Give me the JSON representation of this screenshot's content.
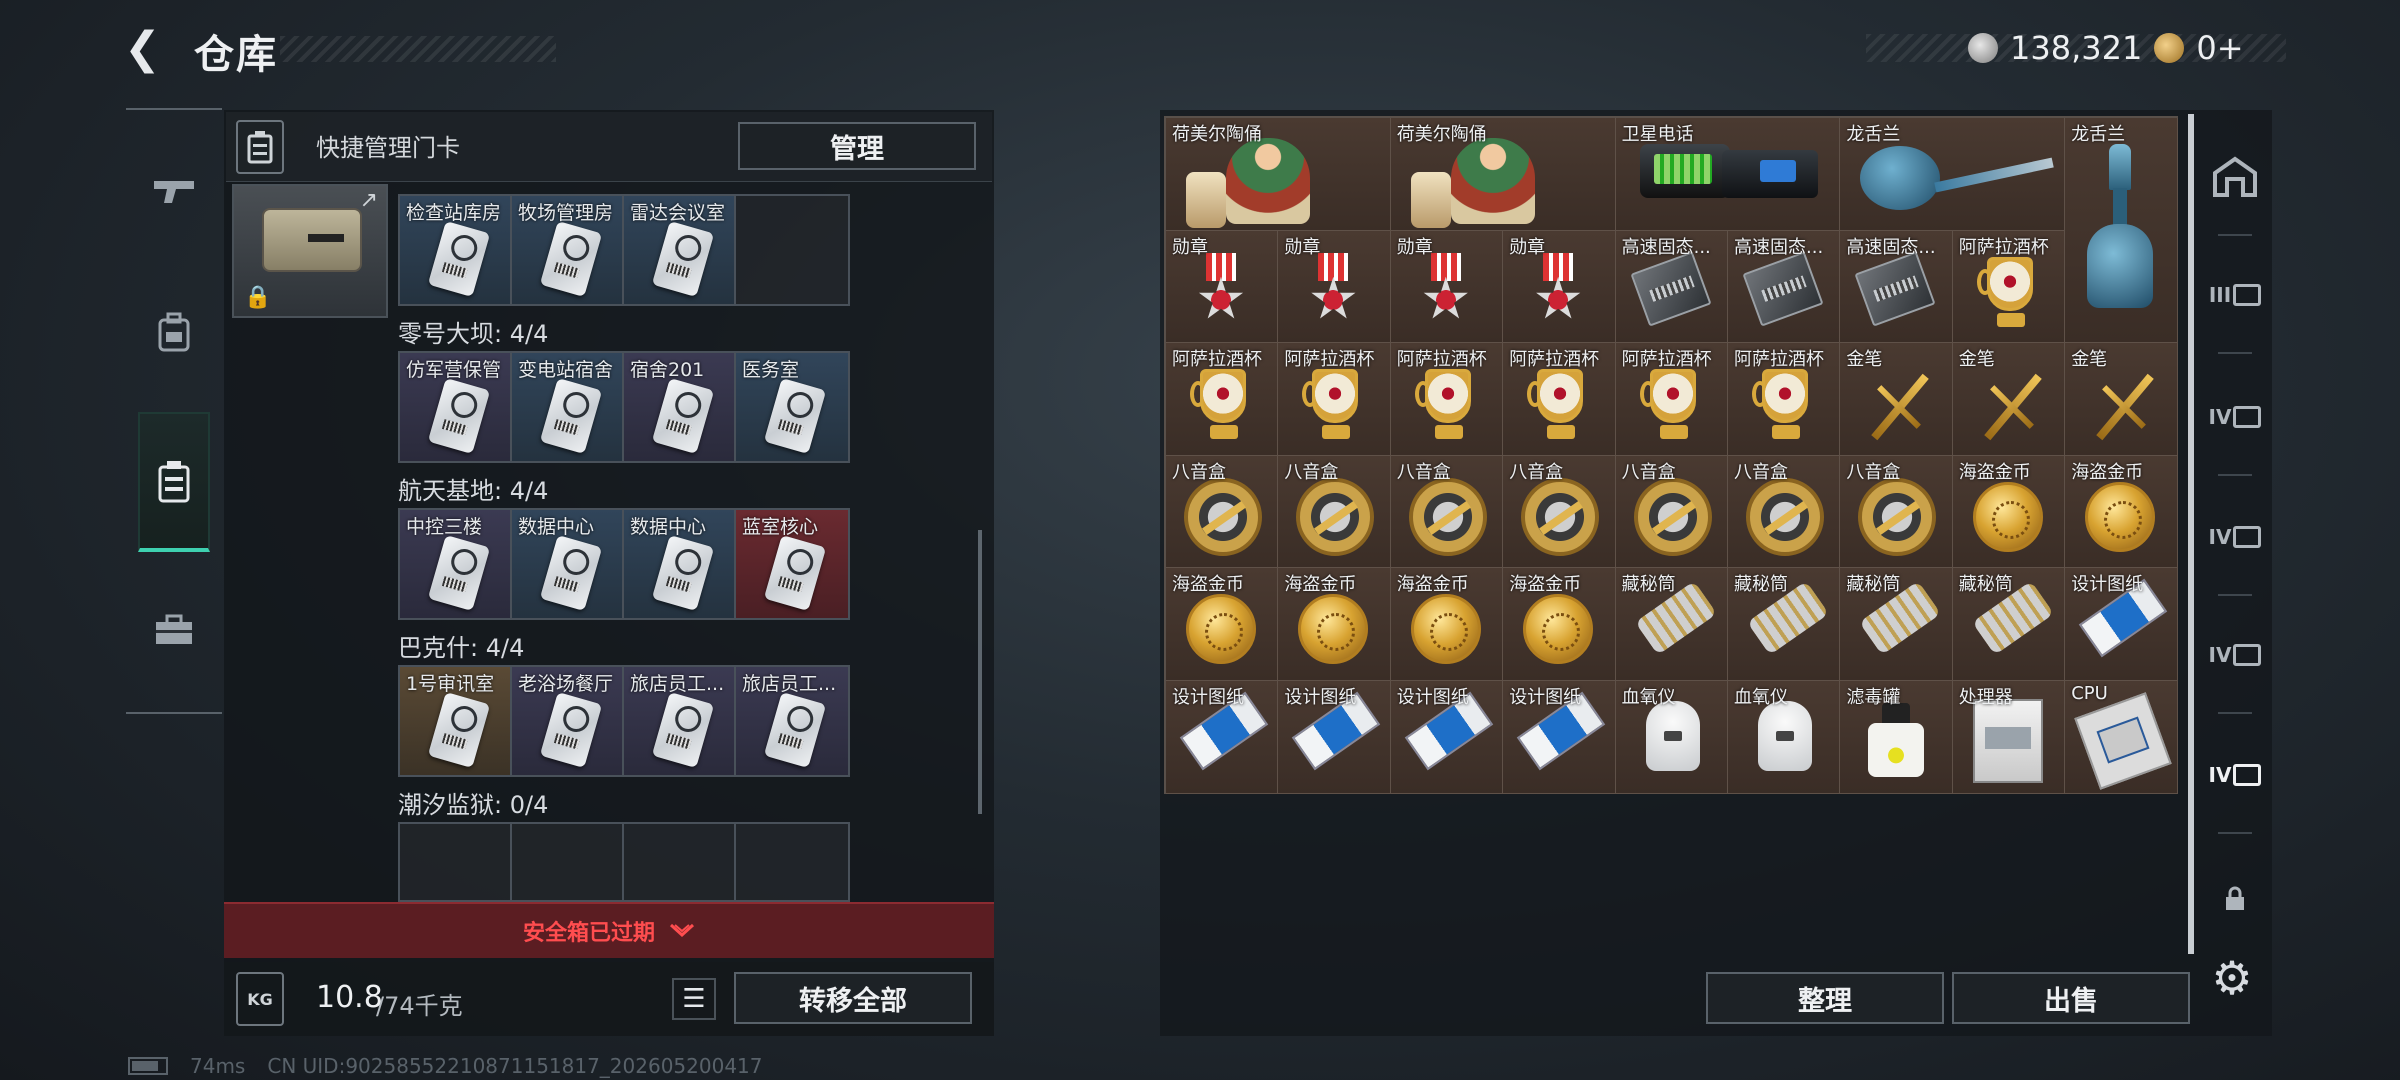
{
  "header": {
    "title": "仓库",
    "currency": [
      {
        "icon": "silver-coin-icon",
        "value": "138,321"
      },
      {
        "icon": "gold-coin-icon",
        "value": "0+"
      }
    ]
  },
  "left_nav": [
    {
      "icon": "gun-icon"
    },
    {
      "icon": "backpack-icon"
    },
    {
      "icon": "keycard-case-icon",
      "active": true
    },
    {
      "icon": "toolbox-icon"
    }
  ],
  "key_panel": {
    "header_label": "快捷管理门卡",
    "manage_button": "管理",
    "sections": [
      {
        "label": "",
        "slots": [
          {
            "name": "检查站库房",
            "color": "blue"
          },
          {
            "name": "牧场管理房",
            "color": "blue"
          },
          {
            "name": "雷达会议室",
            "color": "blue"
          },
          {
            "name": "",
            "color": "empty"
          }
        ]
      },
      {
        "label": "零号大坝: 4/4",
        "slots": [
          {
            "name": "仿军营保管",
            "color": "purple"
          },
          {
            "name": "变电站宿舍",
            "color": "blue"
          },
          {
            "name": "宿舍201",
            "color": "purple"
          },
          {
            "name": "医务室",
            "color": "blue"
          }
        ]
      },
      {
        "label": "航天基地: 4/4",
        "slots": [
          {
            "name": "中控三楼",
            "color": "purple"
          },
          {
            "name": "数据中心",
            "color": "blue"
          },
          {
            "name": "数据中心",
            "color": "blue"
          },
          {
            "name": "蓝室核心",
            "color": "red"
          }
        ]
      },
      {
        "label": "巴克什: 4/4",
        "slots": [
          {
            "name": "1号审讯室",
            "color": "gold"
          },
          {
            "name": "老浴场餐厅",
            "color": "purple"
          },
          {
            "name": "旅店员工...",
            "color": "purple"
          },
          {
            "name": "旅店员工...",
            "color": "purple"
          }
        ]
      },
      {
        "label": "潮汐监狱: 0/4",
        "slots": [
          {
            "name": "",
            "color": "empty"
          },
          {
            "name": "",
            "color": "empty"
          },
          {
            "name": "",
            "color": "empty"
          },
          {
            "name": "",
            "color": "empty"
          }
        ]
      }
    ],
    "expired_label": "安全箱已过期",
    "weight_current": "10.8",
    "weight_max": "/74千克",
    "weight_icon_text": "KG",
    "transfer_button": "转移全部"
  },
  "status_bar": {
    "ping": "74ms",
    "uid": "CN UID:9025855221087115181​7_202605200417"
  },
  "stash": {
    "items": [
      {
        "name": "荷美尔陶俑",
        "art": "fig",
        "w": 2,
        "h": 1
      },
      {
        "name": "荷美尔陶俑",
        "art": "fig",
        "w": 2,
        "h": 1
      },
      {
        "name": "卫星电话",
        "art": "phone",
        "w": 2,
        "h": 1
      },
      {
        "name": "龙舌兰",
        "art": "vase",
        "w": 2,
        "h": 1
      },
      {
        "name": "龙舌兰",
        "art": "bottle",
        "w": 1,
        "h": 2
      },
      {
        "name": "勋章",
        "art": "medal",
        "w": 1,
        "h": 1
      },
      {
        "name": "勋章",
        "art": "medal",
        "w": 1,
        "h": 1
      },
      {
        "name": "勋章",
        "art": "medal",
        "w": 1,
        "h": 1
      },
      {
        "name": "勋章",
        "art": "medal",
        "w": 1,
        "h": 1
      },
      {
        "name": "高速固态...",
        "art": "ssd",
        "w": 1,
        "h": 1
      },
      {
        "name": "高速固态...",
        "art": "ssd",
        "w": 1,
        "h": 1
      },
      {
        "name": "高速固态...",
        "art": "ssd",
        "w": 1,
        "h": 1
      },
      {
        "name": "阿萨拉酒杯",
        "art": "cup",
        "w": 1,
        "h": 1
      },
      {
        "name": "阿萨拉酒杯",
        "art": "cup",
        "w": 1,
        "h": 1
      },
      {
        "name": "阿萨拉酒杯",
        "art": "cup",
        "w": 1,
        "h": 1
      },
      {
        "name": "阿萨拉酒杯",
        "art": "cup",
        "w": 1,
        "h": 1
      },
      {
        "name": "阿萨拉酒杯",
        "art": "cup",
        "w": 1,
        "h": 1
      },
      {
        "name": "阿萨拉酒杯",
        "art": "cup",
        "w": 1,
        "h": 1
      },
      {
        "name": "阿萨拉酒杯",
        "art": "cup",
        "w": 1,
        "h": 1
      },
      {
        "name": "金笔",
        "art": "pen",
        "w": 1,
        "h": 1
      },
      {
        "name": "金笔",
        "art": "pen",
        "w": 1,
        "h": 1
      },
      {
        "name": "金笔",
        "art": "pen",
        "w": 1,
        "h": 1
      },
      {
        "name": "八音盒",
        "art": "music",
        "w": 1,
        "h": 1
      },
      {
        "name": "八音盒",
        "art": "music",
        "w": 1,
        "h": 1
      },
      {
        "name": "八音盒",
        "art": "music",
        "w": 1,
        "h": 1
      },
      {
        "name": "八音盒",
        "art": "music",
        "w": 1,
        "h": 1
      },
      {
        "name": "八音盒",
        "art": "music",
        "w": 1,
        "h": 1
      },
      {
        "name": "八音盒",
        "art": "music",
        "w": 1,
        "h": 1
      },
      {
        "name": "八音盒",
        "art": "music",
        "w": 1,
        "h": 1
      },
      {
        "name": "海盗金币",
        "art": "coin",
        "w": 1,
        "h": 1
      },
      {
        "name": "海盗金币",
        "art": "coin",
        "w": 1,
        "h": 1
      },
      {
        "name": "海盗金币",
        "art": "coin",
        "w": 1,
        "h": 1
      },
      {
        "name": "海盗金币",
        "art": "coin",
        "w": 1,
        "h": 1
      },
      {
        "name": "海盗金币",
        "art": "coin",
        "w": 1,
        "h": 1
      },
      {
        "name": "海盗金币",
        "art": "coin",
        "w": 1,
        "h": 1
      },
      {
        "name": "藏秘筒",
        "art": "cyl",
        "w": 1,
        "h": 1
      },
      {
        "name": "藏秘筒",
        "art": "cyl",
        "w": 1,
        "h": 1
      },
      {
        "name": "藏秘筒",
        "art": "cyl",
        "w": 1,
        "h": 1
      },
      {
        "name": "藏秘筒",
        "art": "cyl",
        "w": 1,
        "h": 1
      },
      {
        "name": "设计图纸",
        "art": "blue",
        "w": 1,
        "h": 1
      },
      {
        "name": "设计图纸",
        "art": "blue",
        "w": 1,
        "h": 1
      },
      {
        "name": "设计图纸",
        "art": "blue",
        "w": 1,
        "h": 1
      },
      {
        "name": "设计图纸",
        "art": "blue",
        "w": 1,
        "h": 1
      },
      {
        "name": "设计图纸",
        "art": "blue",
        "w": 1,
        "h": 1
      },
      {
        "name": "血氧仪",
        "art": "oxi",
        "w": 1,
        "h": 1
      },
      {
        "name": "血氧仪",
        "art": "oxi",
        "w": 1,
        "h": 1
      },
      {
        "name": "滤毒罐",
        "art": "filter",
        "w": 1,
        "h": 1
      },
      {
        "name": "处理器",
        "art": "proc",
        "w": 1,
        "h": 1
      },
      {
        "name": "CPU",
        "art": "cpu",
        "w": 1,
        "h": 1
      }
    ],
    "sort_button": "整理",
    "sell_button": "出售"
  },
  "right_tabs": [
    {
      "icon": "home-stash-icon",
      "text": ""
    },
    {
      "icon": "stash-tab-iii-icon",
      "text": "III"
    },
    {
      "icon": "stash-tab-iv-folder-icon",
      "text": "IV"
    },
    {
      "icon": "stash-tab-iv-icon",
      "text": "IV"
    },
    {
      "icon": "stash-tab-iv-add-icon",
      "text": "IV"
    },
    {
      "icon": "stash-tab-iv-active-icon",
      "text": "IV",
      "active": true
    },
    {
      "icon": "lock-icon",
      "text": ""
    }
  ],
  "colors": {
    "accent": "#3ed1b0",
    "danger": "#ff4d4f",
    "stash_bg": "#3a2f2a"
  }
}
